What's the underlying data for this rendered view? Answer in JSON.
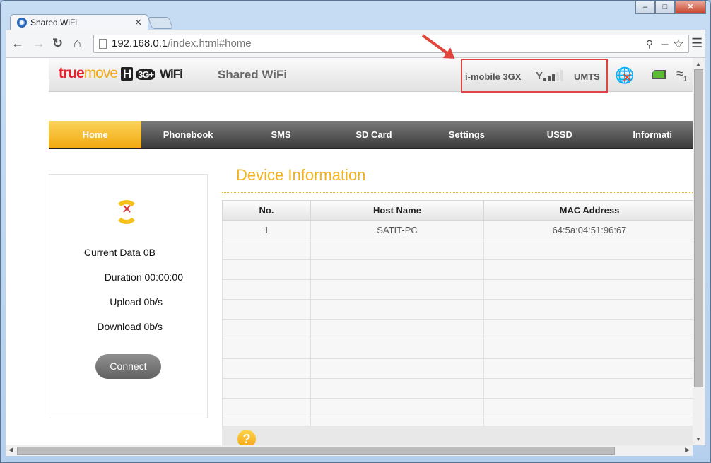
{
  "browser": {
    "tab_title": "Shared WiFi",
    "url_host": "192.168.0.1",
    "url_path": "/index.html#home"
  },
  "header": {
    "logo": {
      "true": "true",
      "move": "move",
      "h": "H",
      "g": "3G+",
      "wifi": "WiFi"
    },
    "site_name": "Shared WiFi",
    "carrier": "i-mobile 3GX",
    "signal_bars": 3,
    "signal_max": 5,
    "network_type": "UMTS",
    "wifi_clients": "1"
  },
  "nav": {
    "items": [
      "Home",
      "Phonebook",
      "SMS",
      "SD Card",
      "Settings",
      "USSD",
      "Informati"
    ],
    "active": "Home"
  },
  "connection": {
    "current_data_label": "Current Data",
    "current_data": "0B",
    "duration_label": "Duration",
    "duration": "00:00:00",
    "upload_label": "Upload",
    "upload": "0b/s",
    "download_label": "Download",
    "download": "0b/s",
    "connect_label": "Connect"
  },
  "device_info": {
    "title": "Device Information",
    "columns": [
      "No.",
      "Host Name",
      "MAC Address"
    ],
    "rows": [
      [
        "1",
        "SATIT-PC",
        "64:5a:04:51:96:67"
      ]
    ],
    "empty_rows": 10
  },
  "colors": {
    "accent": "#f2b21e",
    "highlight_box": "#e04444"
  }
}
